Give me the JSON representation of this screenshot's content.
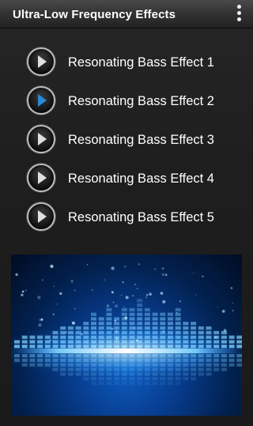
{
  "app": {
    "title": "Ultra-Low Frequency Effects",
    "menu_icon": "more-vert-icon"
  },
  "effects": [
    {
      "label": "Resonating Bass Effect 1",
      "state": "idle"
    },
    {
      "label": "Resonating Bass Effect 2",
      "state": "selected"
    },
    {
      "label": "Resonating Bass Effect 3",
      "state": "idle"
    },
    {
      "label": "Resonating Bass Effect 4",
      "state": "idle"
    },
    {
      "label": "Resonating Bass Effect 5",
      "state": "idle"
    }
  ],
  "colors": {
    "play_icon_idle": "#e0e0e0",
    "play_icon_selected": "#2a8bd8",
    "banner_glow": "#7fd4ff"
  },
  "banner": {
    "image": "blue-equalizer-visual"
  }
}
